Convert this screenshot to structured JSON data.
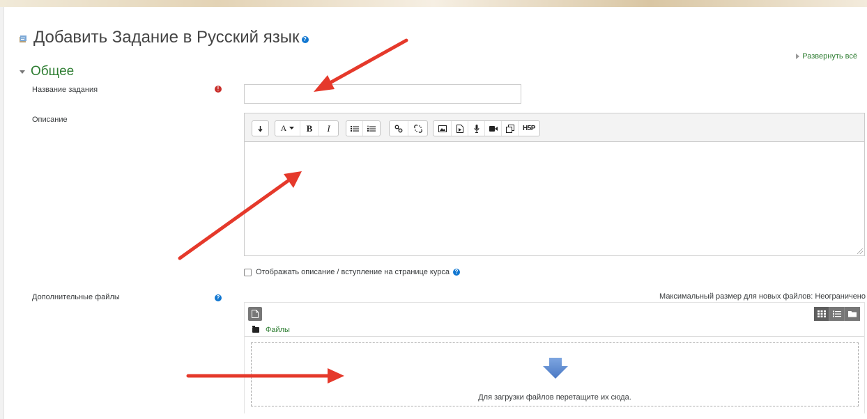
{
  "page": {
    "title": "Добавить Задание в Русский язык"
  },
  "expand_all": "Развернуть всё",
  "section": {
    "title": "Общее"
  },
  "fields": {
    "name": {
      "label": "Название задания",
      "value": ""
    },
    "description": {
      "label": "Описание",
      "value": ""
    },
    "show_description": {
      "label": "Отображать описание / вступление на странице курса",
      "checked": false
    },
    "additional_files": {
      "label": "Дополнительные файлы"
    }
  },
  "editor": {
    "toolbar": [
      [
        "collapse-icon"
      ],
      [
        "font-style-icon",
        "bold-icon",
        "italic-icon"
      ],
      [
        "bullet-list-icon",
        "numbered-list-icon"
      ],
      [
        "link-icon",
        "unlink-icon"
      ],
      [
        "image-icon",
        "media-icon",
        "microphone-icon",
        "video-icon",
        "manage-files-icon",
        "h5p-icon"
      ]
    ],
    "labels": {
      "font_style": "A",
      "bold": "B",
      "italic": "I",
      "h5p": "H5P"
    }
  },
  "filemanager": {
    "max_size": "Максимальный размер для новых файлов: Неограничено",
    "folder": "Файлы",
    "dropzone_text": "Для загрузки файлов перетащите их сюда."
  },
  "colors": {
    "link_green": "#2e7d32",
    "required_red": "#c9302c",
    "help_blue": "#1177d1",
    "annotation_red": "#e5392b"
  }
}
